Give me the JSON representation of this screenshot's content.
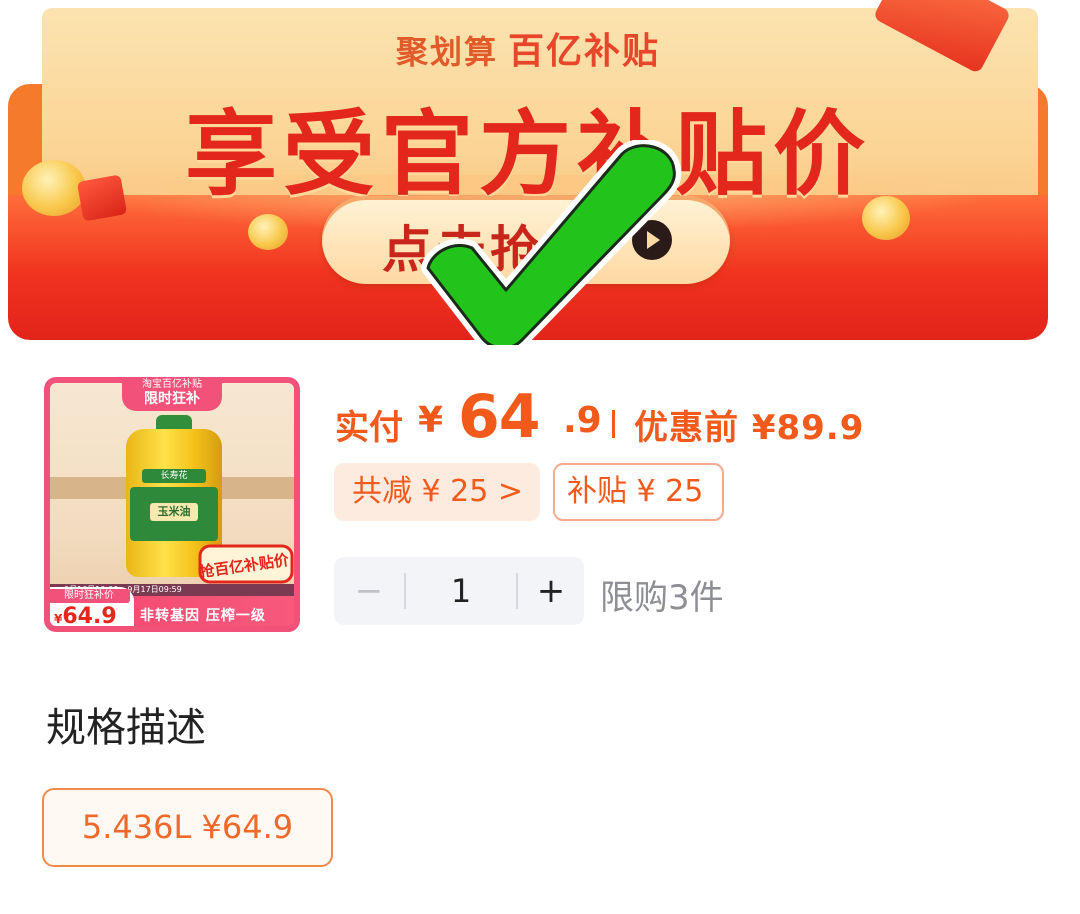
{
  "banner": {
    "sub_prefix": "聚划算",
    "sub_title": "百亿补贴",
    "main_title": "享受官方补贴价",
    "cta_label": "点击抢"
  },
  "product": {
    "thumb": {
      "top_small": "淘宝百亿补贴",
      "top_big": "限时狂补",
      "brand": "长寿花",
      "label": "玉米油",
      "stamp": "抢百亿补贴价",
      "dates": "9月16日10:00 – 9月17日09:59",
      "price_label": "限时狂补价",
      "price_yen": "¥",
      "price": "64.9",
      "slogan": "非转基因 压榨一级"
    },
    "pay_label": "实付",
    "pay_yen": "¥",
    "pay_int": "64",
    "pay_dec": ".9",
    "pre_label": "优惠前 ¥89.9",
    "reduce_chip": "共减 ¥ 25 >",
    "subsidy_chip": "补贴 ¥ 25",
    "quantity": {
      "minus": "−",
      "value": "1",
      "plus": "+"
    },
    "limit": "限购3件"
  },
  "spec": {
    "title": "规格描述",
    "option": "5.436L  ¥64.9"
  },
  "colors": {
    "accent": "#f15a1b",
    "banner_red": "#e3271c",
    "check_green": "#22c41c"
  }
}
